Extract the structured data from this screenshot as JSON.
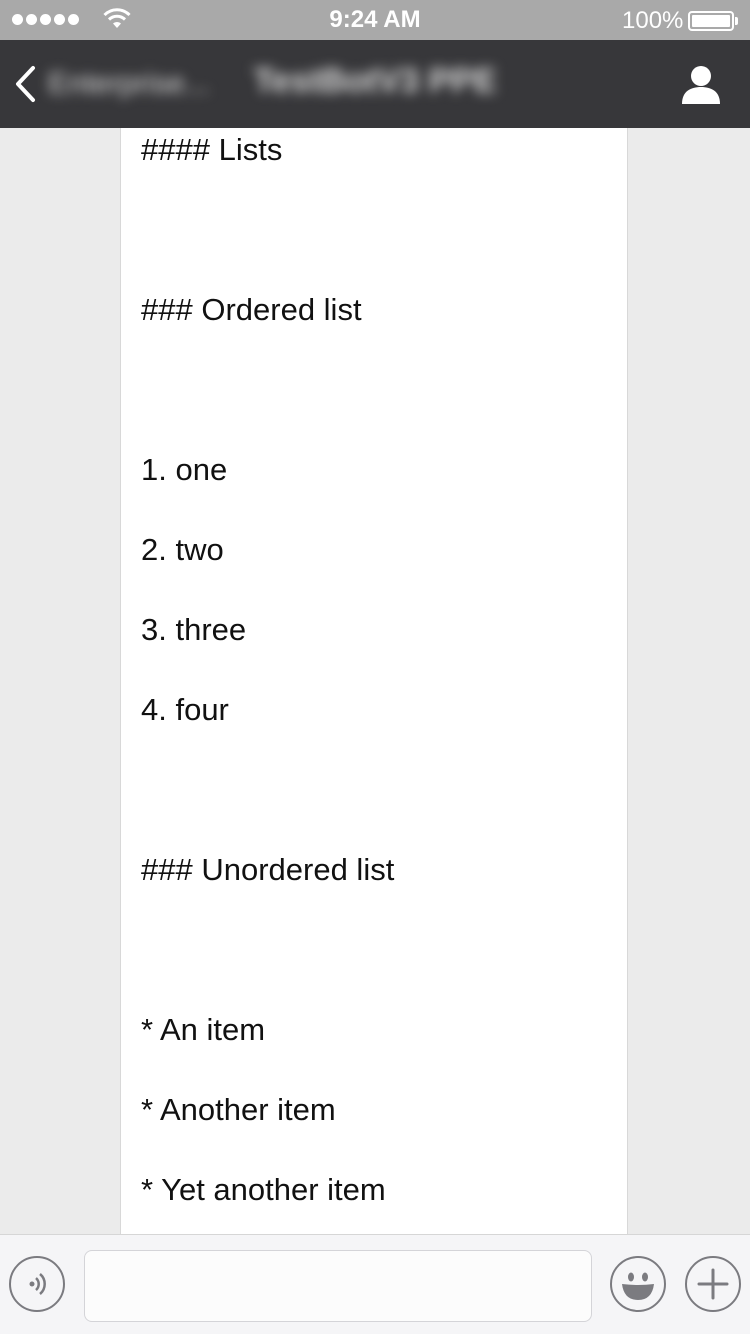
{
  "status_bar": {
    "time": "9:24 AM",
    "battery_percent": "100%",
    "battery_level": 1.0,
    "signal_icon": "signal-dots-icon",
    "wifi_icon": "wifi-icon"
  },
  "nav": {
    "back_label": "Enterprise...",
    "title": "TestBotV3 PPE",
    "back_icon": "chevron-left-icon",
    "profile_icon": "person-icon"
  },
  "message": {
    "lines": [
      "#### Lists",
      "### Ordered list",
      "1. one",
      "2. two",
      "3. three",
      "4. four",
      "### Unordered list",
      "* An item",
      "* Another item",
      "* Yet another item"
    ]
  },
  "input_bar": {
    "placeholder": "",
    "voice_icon": "voice-icon",
    "emoji_icon": "emoji-icon",
    "plus_icon": "plus-icon"
  },
  "colors": {
    "status_bar": "#a9a9a9",
    "nav_bar": "#37373a",
    "chat_background": "#ebebeb",
    "bubble": "#ffffff"
  }
}
